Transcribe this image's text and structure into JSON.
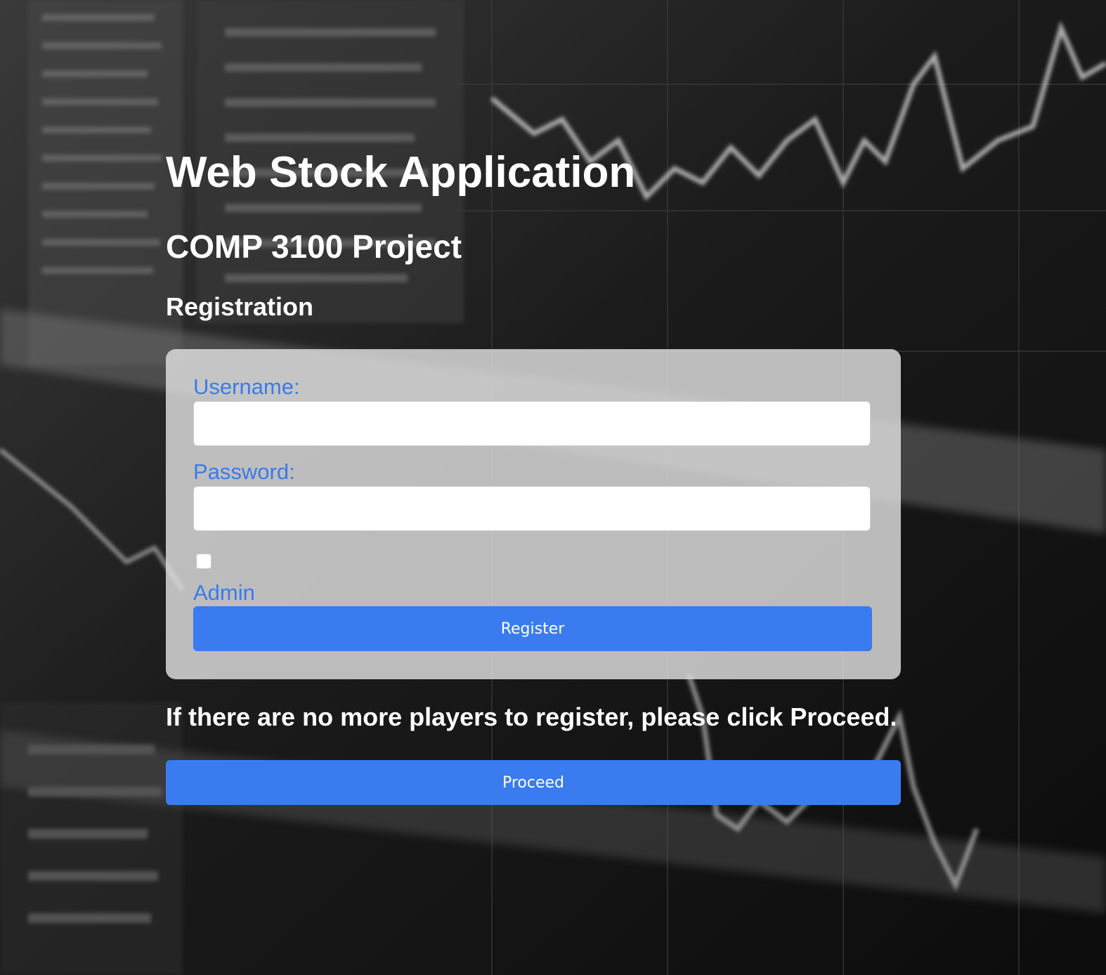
{
  "header": {
    "title": "Web Stock Application",
    "subtitle": "COMP 3100 Project",
    "section": "Registration"
  },
  "form": {
    "username_label": "Username:",
    "username_value": "",
    "password_label": "Password:",
    "password_value": "",
    "admin_label": "Admin",
    "admin_checked": false,
    "register_label": "Register"
  },
  "footer": {
    "notice": "If there are no more players to register, please click Proceed.",
    "proceed_label": "Proceed"
  },
  "colors": {
    "accent": "#3a7bf0",
    "label": "#3a7be8",
    "card_bg": "rgba(225,225,225,0.82)",
    "text": "#ffffff"
  },
  "icons": {
    "background": "stock-chart-background-image"
  }
}
